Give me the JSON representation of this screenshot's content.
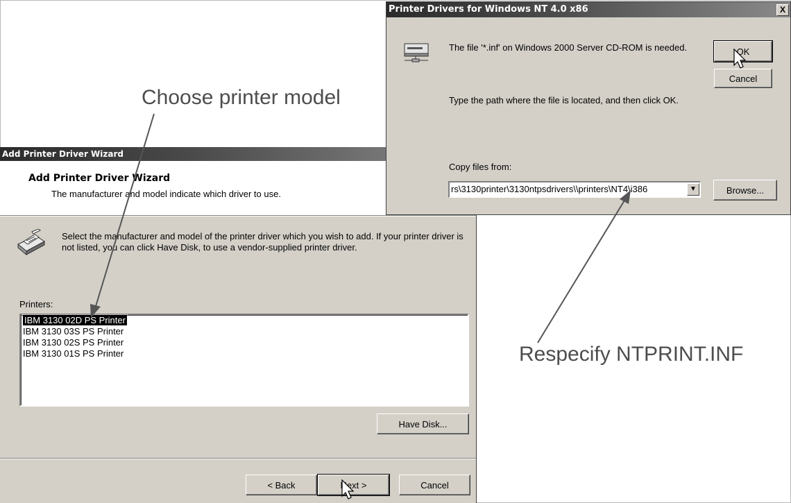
{
  "callouts": {
    "choose_model": "Choose printer model",
    "respecify": "Respecify NTPRINT.INF"
  },
  "wizard": {
    "window_title": "Add Printer Driver Wizard",
    "header_title": "Add Printer Driver Wizard",
    "header_subtitle": "The manufacturer and model indicate which driver to use.",
    "instructions": "Select the manufacturer and model of the printer driver which you wish to add. If your printer driver is not listed, you can click Have Disk, to use a vendor-supplied printer driver.",
    "printers_label": "Printers:",
    "printers": [
      "IBM 3130 02D PS Printer",
      "IBM 3130 03S PS Printer",
      "IBM 3130 02S PS Printer",
      "IBM 3130 01S PS Printer"
    ],
    "selected_printer": "IBM 3130 02D PS Printer",
    "have_disk_label": "Have Disk...",
    "back_label": "< Back",
    "next_label": "Next >",
    "cancel_label": "Cancel"
  },
  "dialog": {
    "title": "Printer Drivers for Windows NT 4.0 x86",
    "close_label": "X",
    "message": "The file '*.inf' on Windows 2000 Server CD-ROM is needed.",
    "instruction": "Type the path where the file is located, and then click OK.",
    "copy_from_label": "Copy files from:",
    "copy_from_value": "rs\\3130printer\\3130ntpsdrivers\\\\printers\\NT4\\i386",
    "ok_label": "OK",
    "cancel_label": "Cancel",
    "browse_label": "Browse..."
  },
  "icons": {
    "wizard_printer": "printer-icon",
    "dialog_drive": "cd-drive-icon",
    "combo_arrow": "chevron-down-icon",
    "cursor": "mouse-cursor-icon"
  }
}
